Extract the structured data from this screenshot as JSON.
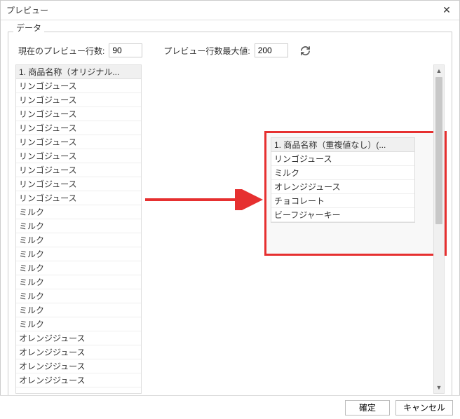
{
  "window": {
    "title": "プレビュー",
    "close": "✕"
  },
  "fieldset": {
    "label": "データ"
  },
  "toolbar": {
    "current_rows_label": "現在のプレビュー行数:",
    "current_rows_value": "90",
    "max_rows_label": "プレビュー行数最大値:",
    "max_rows_value": "200"
  },
  "left_table": {
    "header": "1. 商品名称（オリジナル...",
    "rows": [
      "リンゴジュース",
      "リンゴジュース",
      "リンゴジュース",
      "リンゴジュース",
      "リンゴジュース",
      "リンゴジュース",
      "リンゴジュース",
      "リンゴジュース",
      "リンゴジュース",
      "ミルク",
      "ミルク",
      "ミルク",
      "ミルク",
      "ミルク",
      "ミルク",
      "ミルク",
      "ミルク",
      "ミルク",
      "オレンジジュース",
      "オレンジジュース",
      "オレンジジュース",
      "オレンジジュース"
    ]
  },
  "result_table": {
    "header": "1. 商品名称（重複値なし）(...",
    "rows": [
      "リンゴジュース",
      "ミルク",
      "オレンジジュース",
      "チョコレート",
      "ビーフジャーキー"
    ]
  },
  "footer": {
    "ok": "確定",
    "cancel": "キャンセル"
  }
}
